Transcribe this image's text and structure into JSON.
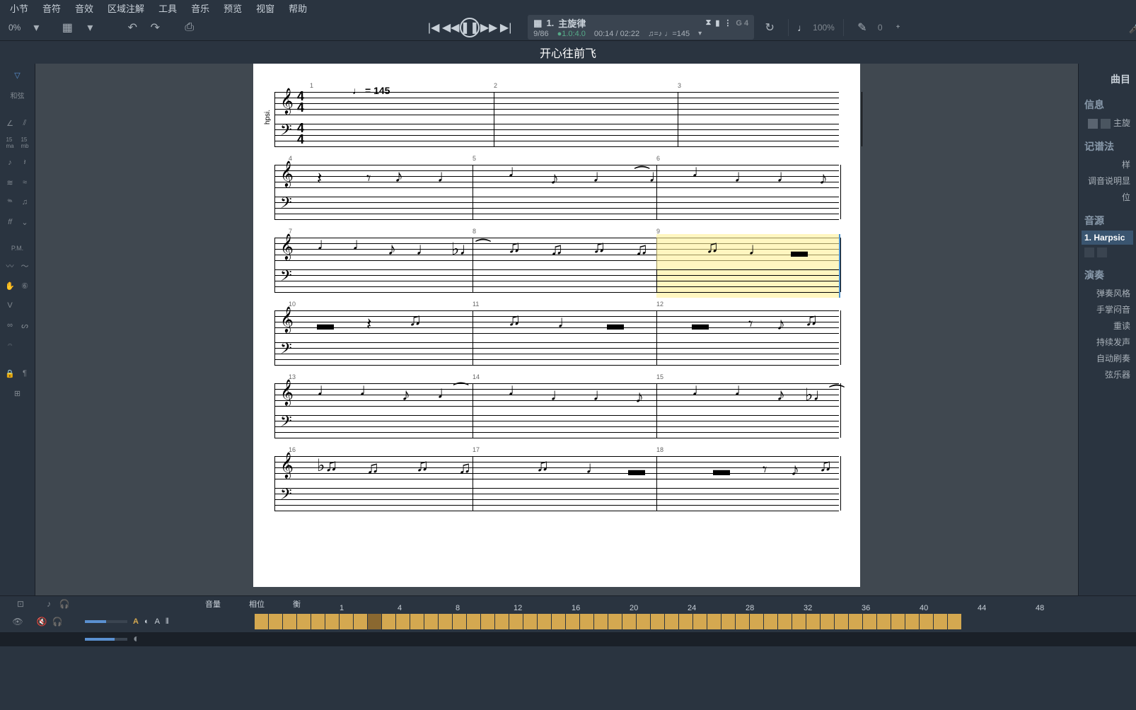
{
  "menu": {
    "items": [
      "小节",
      "音符",
      "音效",
      "区域注解",
      "工具",
      "音乐",
      "预览",
      "视窗",
      "帮助"
    ]
  },
  "toolbar": {
    "zoom": "0%"
  },
  "transport": {
    "track_number": "1.",
    "track_name": "主旋律",
    "position": "9/86",
    "beat": "1.0:4.0",
    "time_current": "00:14",
    "time_total": "02:22",
    "tempo": "145",
    "note_info": "G 4",
    "speed_percent": "100%",
    "transpose": "0"
  },
  "score": {
    "title": "开心往前飞",
    "tempo_mark": "= 145",
    "instrument": "hpsi.",
    "time_sig_top": "4",
    "time_sig_bottom": "4",
    "systems": [
      {
        "measures": [
          1,
          2,
          3
        ],
        "first": true
      },
      {
        "measures": [
          4,
          5,
          6
        ]
      },
      {
        "measures": [
          7,
          8,
          9
        ],
        "highlight_measure": 9
      },
      {
        "measures": [
          10,
          11,
          12
        ]
      },
      {
        "measures": [
          13,
          14,
          15
        ]
      },
      {
        "measures": [
          16,
          17,
          18
        ]
      }
    ]
  },
  "right_panel": {
    "tab": "曲目",
    "sections": {
      "info": {
        "title": "信息",
        "items": [
          "主旋"
        ]
      },
      "notation": {
        "title": "记谱法",
        "items": [
          "样",
          "调音说明显",
          "位"
        ]
      },
      "source": {
        "title": "音源",
        "items": [
          "1. Harpsic"
        ]
      },
      "performance": {
        "title": "演奏",
        "items": [
          "弹奏风格",
          "手掌闷音",
          "重读",
          "持续发声",
          "自动刷奏",
          "弦乐器"
        ]
      }
    }
  },
  "bottom": {
    "label_volume": "音量",
    "label_phase": "相位",
    "label_balance": "衡",
    "ruler_marks": [
      1,
      4,
      8,
      12,
      16,
      20,
      24,
      28,
      32,
      36,
      40,
      44,
      48
    ]
  }
}
